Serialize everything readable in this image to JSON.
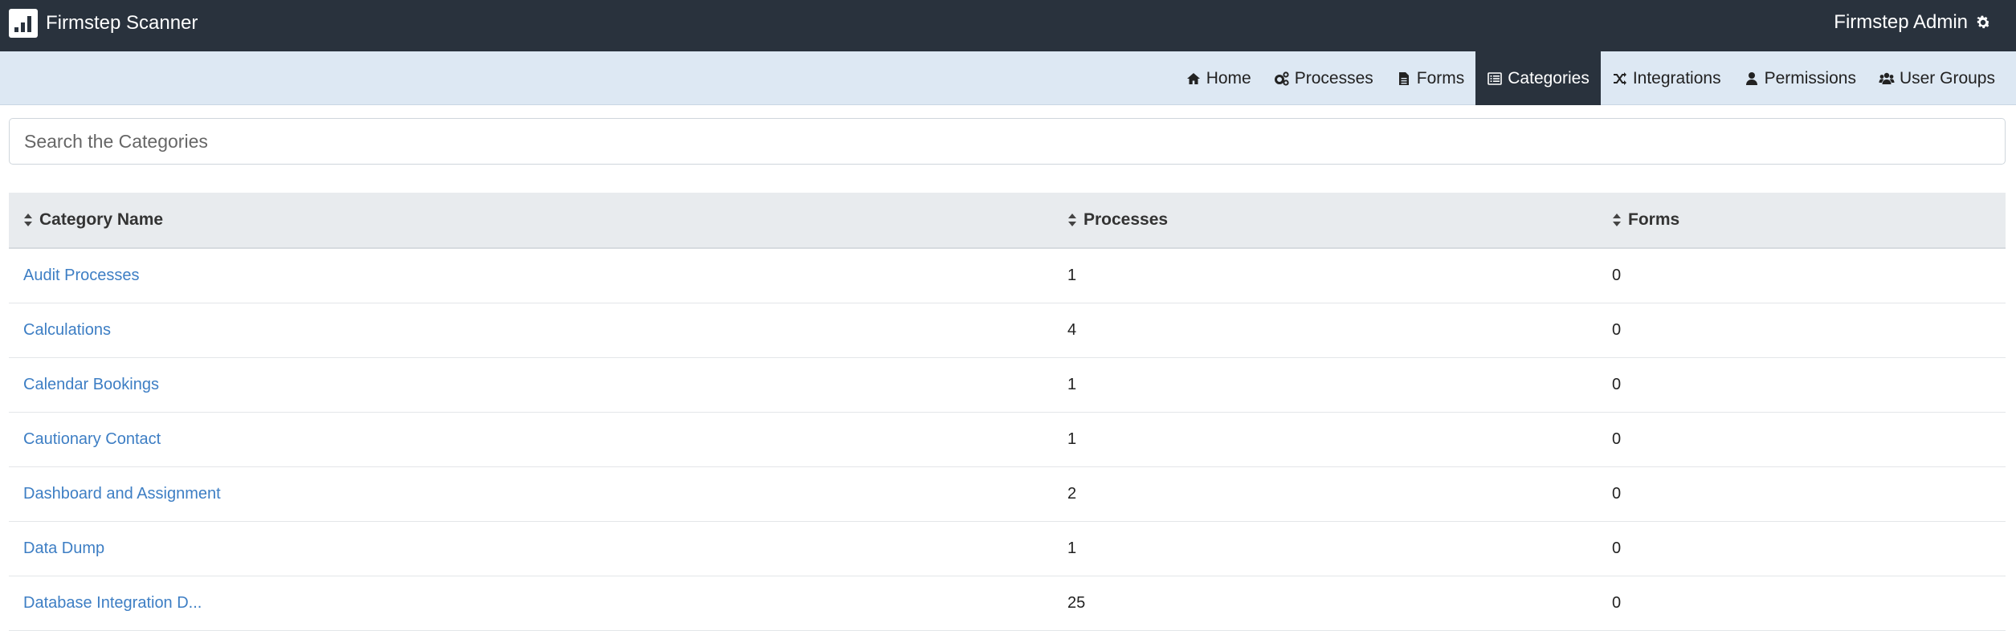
{
  "app": {
    "title": "Firmstep Scanner",
    "user": "Firmstep Admin"
  },
  "nav": [
    {
      "label": "Home",
      "icon": "home-icon",
      "active": false
    },
    {
      "label": "Processes",
      "icon": "cogs-icon",
      "active": false
    },
    {
      "label": "Forms",
      "icon": "file-icon",
      "active": false
    },
    {
      "label": "Categories",
      "icon": "list-icon",
      "active": true
    },
    {
      "label": "Integrations",
      "icon": "shuffle-icon",
      "active": false
    },
    {
      "label": "Permissions",
      "icon": "user-icon",
      "active": false
    },
    {
      "label": "User Groups",
      "icon": "users-icon",
      "active": false
    }
  ],
  "search": {
    "placeholder": "Search the Categories",
    "value": ""
  },
  "table": {
    "headers": [
      "Category Name",
      "Processes",
      "Forms"
    ],
    "rows": [
      {
        "name": "Audit Processes",
        "processes": "1",
        "forms": "0"
      },
      {
        "name": "Calculations",
        "processes": "4",
        "forms": "0"
      },
      {
        "name": "Calendar Bookings",
        "processes": "1",
        "forms": "0"
      },
      {
        "name": "Cautionary Contact",
        "processes": "1",
        "forms": "0"
      },
      {
        "name": "Dashboard and Assignment",
        "processes": "2",
        "forms": "0"
      },
      {
        "name": "Data Dump",
        "processes": "1",
        "forms": "0"
      },
      {
        "name": "Database Integration D...",
        "processes": "25",
        "forms": "0"
      }
    ]
  },
  "colors": {
    "topbar": "#29323d",
    "navbar": "#dde8f3",
    "link": "#3d7ec4",
    "header_bg": "#e8ebee"
  }
}
